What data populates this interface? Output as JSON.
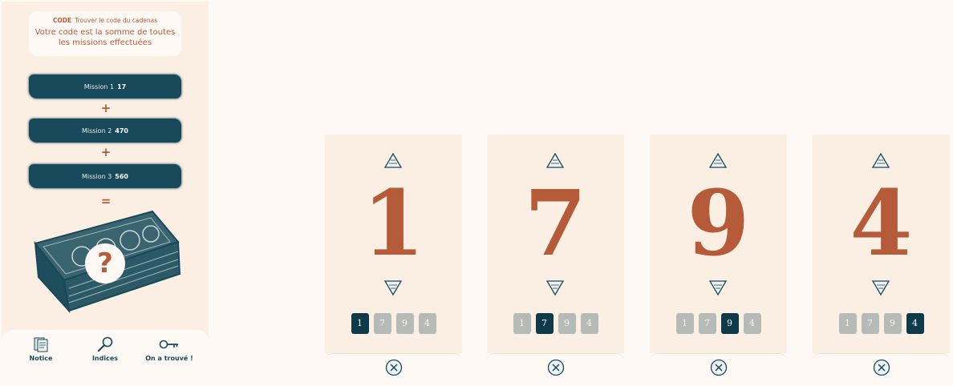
{
  "code_card": {
    "tag": "CODE",
    "subtitle": "Trouver le code du cadenas",
    "text": "Votre code est la somme de toutes les missions effectuées"
  },
  "missions": [
    {
      "label": "Mission 1",
      "value": "17"
    },
    {
      "label": "Mission 2",
      "value": "470"
    },
    {
      "label": "Mission 3",
      "value": "560"
    }
  ],
  "operators": [
    "+",
    "+",
    "="
  ],
  "unknown_symbol": "?",
  "nav": [
    {
      "label": "Notice",
      "icon": "document-icon"
    },
    {
      "label": "Indices",
      "icon": "magnifier-icon"
    },
    {
      "label": "On a trouvé !",
      "icon": "key-icon"
    }
  ],
  "columns": [
    {
      "digit": "1",
      "active_index": 0
    },
    {
      "digit": "7",
      "active_index": 1
    },
    {
      "digit": "9",
      "active_index": 2
    },
    {
      "digit": "4",
      "active_index": 3
    }
  ],
  "chip_values": [
    "1",
    "7",
    "9",
    "4"
  ],
  "colors": {
    "accent": "#b65b39",
    "dark_teal": "#18495a",
    "panel_bg": "#fbeee3",
    "page_bg": "#fef9f5",
    "chip_inactive": "#b7bbb7"
  }
}
